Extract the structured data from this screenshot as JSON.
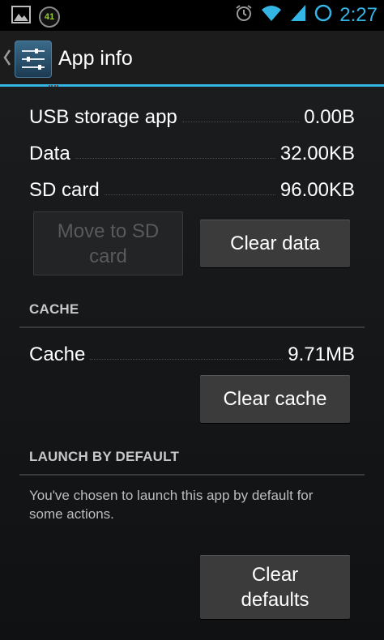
{
  "status_bar": {
    "clock": "2:27",
    "notification_badge": "41",
    "accent_color": "#33b5e5"
  },
  "action_bar": {
    "title": "App info"
  },
  "storage": {
    "rows": [
      {
        "label": "USB storage app",
        "value": "0.00B"
      },
      {
        "label": "Data",
        "value": "32.00KB"
      },
      {
        "label": "SD card",
        "value": "96.00KB"
      }
    ],
    "move_button": "Move to SD card",
    "clear_data_button": "Clear data"
  },
  "cache": {
    "header": "CACHE",
    "row": {
      "label": "Cache",
      "value": "9.71MB"
    },
    "clear_cache_button": "Clear cache"
  },
  "launch_default": {
    "header": "LAUNCH BY DEFAULT",
    "description": "You've chosen to launch this app by default for some actions.",
    "clear_defaults_button": "Clear defaults"
  }
}
